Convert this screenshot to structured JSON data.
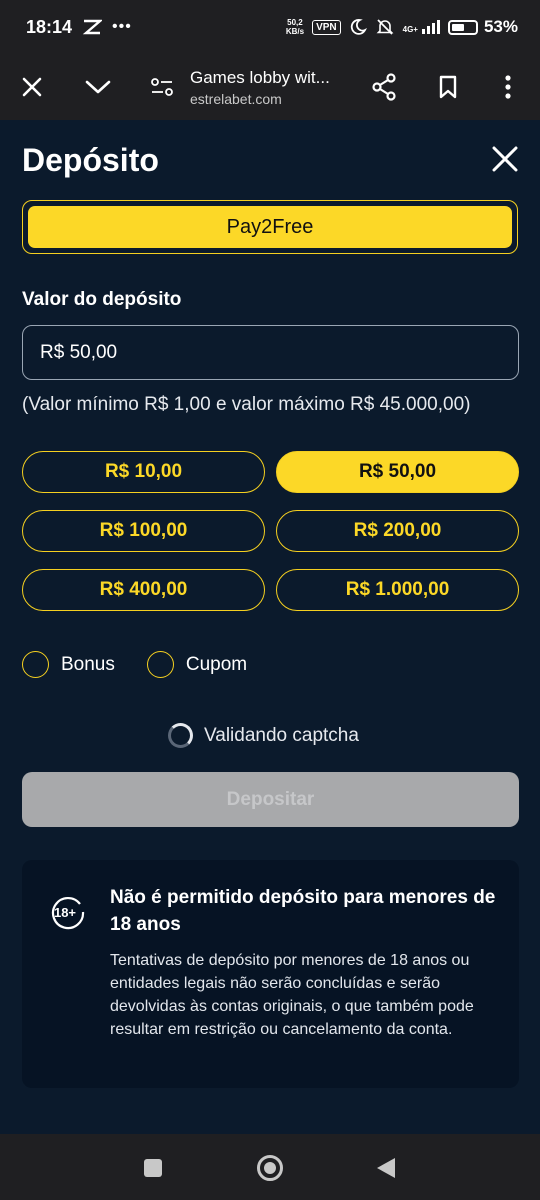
{
  "status_bar": {
    "time": "18:14",
    "net_speed_value": "50,2",
    "net_speed_unit": "KB/s",
    "vpn": "VPN",
    "network_type": "4G+",
    "battery": "53%",
    "battery_level": 0.53
  },
  "browser": {
    "tab_title": "Games lobby wit...",
    "domain": "estrelabet.com"
  },
  "modal": {
    "title": "Depósito",
    "method_button": "Pay2Free",
    "amount_label": "Valor do depósito",
    "amount_value": "R$ 50,00",
    "limits_hint": "(Valor mínimo R$ 1,00 e valor máximo R$ 45.000,00)",
    "quick_amounts": [
      "R$ 10,00",
      "R$ 50,00",
      "R$ 100,00",
      "R$ 200,00",
      "R$ 400,00",
      "R$ 1.000,00"
    ],
    "selected_amount": "R$ 50,00",
    "bonus_label": "Bonus",
    "coupon_label": "Cupom",
    "captcha_status": "Validando captcha",
    "submit_label": "Depositar",
    "age_badge": "18+",
    "notice_title": "Não é permitido depósito para menores de 18 anos",
    "notice_body": "Tentativas de depósito por menores de 18 anos ou entidades legais não serão concluídas e serão devolvidas às contas originais, o que também pode resultar em restrição ou cancelamento da conta."
  },
  "colors": {
    "background": "#0b1a2c",
    "accent": "#fcd827",
    "disabled": "#a8a9ab",
    "notice_bg": "#061324"
  }
}
